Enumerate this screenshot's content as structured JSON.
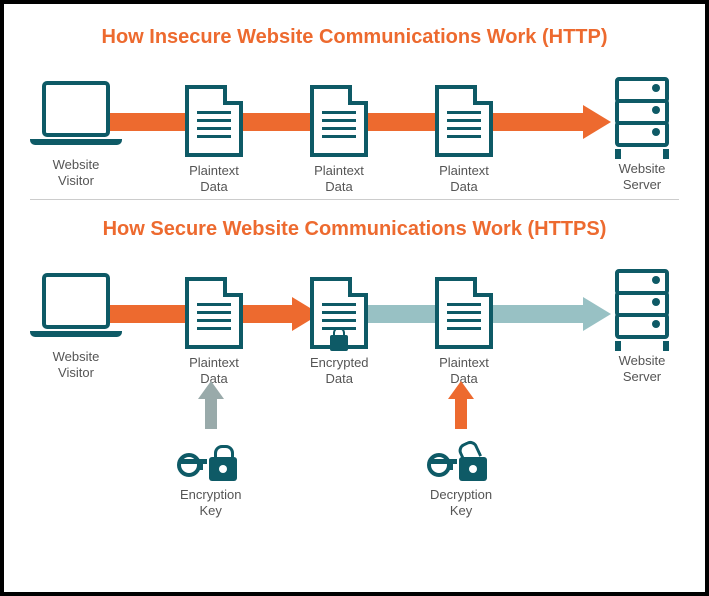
{
  "http": {
    "title": "How Insecure Website Communications Work (HTTP)",
    "visitor": "Website\nVisitor",
    "data1": "Plaintext\nData",
    "data2": "Plaintext\nData",
    "data3": "Plaintext\nData",
    "server": "Website\nServer"
  },
  "https": {
    "title": "How Secure Website Communications Work (HTTPS)",
    "visitor": "Website\nVisitor",
    "data1": "Plaintext\nData",
    "data2": "Encrypted\nData",
    "data3": "Plaintext\nData",
    "server": "Website\nServer",
    "enc_key": "Encryption\nKey",
    "dec_key": "Decryption\nKey"
  }
}
